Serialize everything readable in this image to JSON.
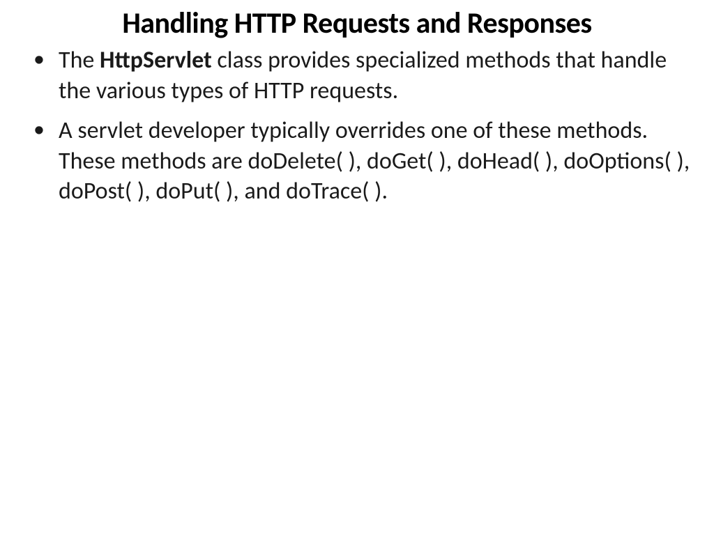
{
  "slide": {
    "title": "Handling HTTP Requests and Responses",
    "bullets": [
      {
        "prefix": "The ",
        "bold": "HttpServlet",
        "suffix": " class provides specialized methods that handle the various types of HTTP requests."
      },
      {
        "text": "A servlet developer typically overrides one of these methods. These methods are doDelete( ), doGet( ), doHead( ), doOptions( ), doPost( ), doPut( ), and doTrace( )."
      }
    ]
  }
}
